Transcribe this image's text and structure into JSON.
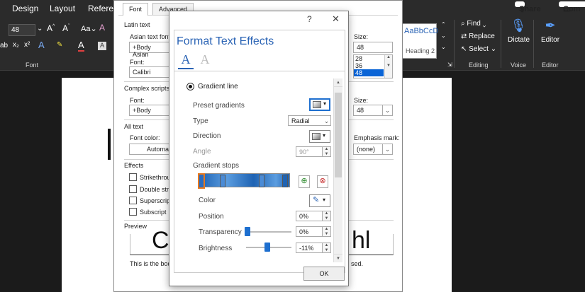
{
  "ribbon_tabs": {
    "design": "Design",
    "layout": "Layout",
    "references": "Referenc",
    "share": "Share",
    "comments": "Com"
  },
  "ribbon": {
    "font_size": "48",
    "font_group_label": "Font",
    "style_preview": "AaBbCcD",
    "heading2": "Heading 2",
    "find": "Find",
    "replace": "Replace",
    "select": "Select",
    "editing_label": "Editing",
    "dictate": "Dictate",
    "voice_label": "Voice",
    "editor": "Editor",
    "editor_label": "Editor"
  },
  "font_dialog": {
    "tab_font": "Font",
    "tab_advanced": "Advanced",
    "latin_text": "Latin text",
    "asian_text_font_label": "Asian text font:",
    "asian_text_font_value": "+Body Asian",
    "font_label": "Font:",
    "font_value": "Calibri",
    "size_label": "Size:",
    "size_value": "48",
    "size_list": [
      "28",
      "36",
      "48"
    ],
    "complex_scripts": "Complex scripts",
    "cs_font_label": "Font:",
    "cs_font_value": "+Body",
    "cs_size_label": "Size:",
    "cs_size_value": "48",
    "all_text": "All text",
    "font_color_label": "Font color:",
    "font_color_value": "Automat",
    "emphasis_label": "Emphasis mark:",
    "emphasis_value": "(none)",
    "effects": "Effects",
    "strikethrough": "Strikethrou",
    "double_strike": "Double stri",
    "superscript": "Superscript",
    "subscript": "Subscript",
    "preview_label": "Preview",
    "preview_text": "This is the body",
    "preview_tail": "sed."
  },
  "fte": {
    "help": "?",
    "close": "✕",
    "title": "Format Text Effects",
    "gradient_line": "Gradient line",
    "preset_gradients": "Preset gradients",
    "type_label": "Type",
    "type_value": "Radial",
    "direction_label": "Direction",
    "angle_label": "Angle",
    "angle_value": "90°",
    "gradient_stops": "Gradient stops",
    "color_label": "Color",
    "position_label": "Position",
    "position_value": "0%",
    "transparency_label": "Transparency",
    "transparency_value": "0%",
    "transparency_level": 0,
    "brightness_label": "Brightness",
    "brightness_value": "-11%",
    "brightness_level": -0.11,
    "ok": "OK"
  },
  "colors": {
    "accent": "#2b64b5",
    "gradient_dark": "#1f63b3",
    "gradient_light": "#5b9de0",
    "selected_stop": "#e6781e"
  }
}
